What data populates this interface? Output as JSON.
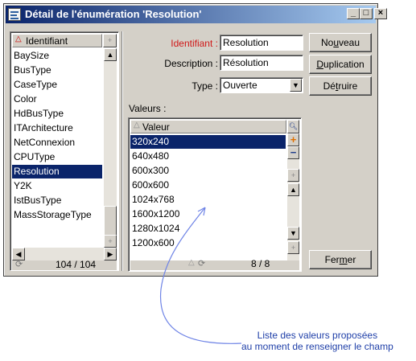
{
  "window": {
    "title": "Détail de l'énumération 'Resolution'",
    "minimize": "_",
    "maximize": "□",
    "close": "×"
  },
  "left_list": {
    "header": "Identifiant",
    "items": [
      "BaySize",
      "BusType",
      "CaseType",
      "Color",
      "HdBusType",
      "ITArchitecture",
      "NetConnexion",
      "CPUType",
      "Resolution",
      "Y2K",
      "IstBusType",
      "MassStorageType"
    ],
    "selected_index": 8,
    "counter": "104 / 104"
  },
  "form": {
    "identifiant_label": "Identifiant :",
    "identifiant_value": "Resolution",
    "description_label": "Description :",
    "description_value": "Résolution",
    "type_label": "Type :",
    "type_value": "Ouverte",
    "valeurs_label": "Valeurs :"
  },
  "values_list": {
    "header": "Valeur",
    "items": [
      "320x240",
      "640x480",
      "600x300",
      "600x600",
      "1024x768",
      "1600x1200",
      "1280x1024",
      "1200x600"
    ],
    "selected_index": 0,
    "counter": "8 / 8"
  },
  "buttons": {
    "nouveau_pre": "No",
    "nouveau_u": "u",
    "nouveau_post": "veau",
    "duplication_pre": "",
    "duplication_u": "D",
    "duplication_post": "uplication",
    "detruire_pre": "Dé",
    "detruire_u": "t",
    "detruire_post": "ruire",
    "fermer_pre": "Fer",
    "fermer_u": "m",
    "fermer_post": "er"
  },
  "annotation": {
    "line1": "Liste des valeurs proposées",
    "line2": "au moment de renseigner le champ"
  },
  "colors": {
    "selection": "#0a246a",
    "title_start": "#0a246a",
    "required_label": "#d01818",
    "annotation": "#1f3fa8"
  }
}
